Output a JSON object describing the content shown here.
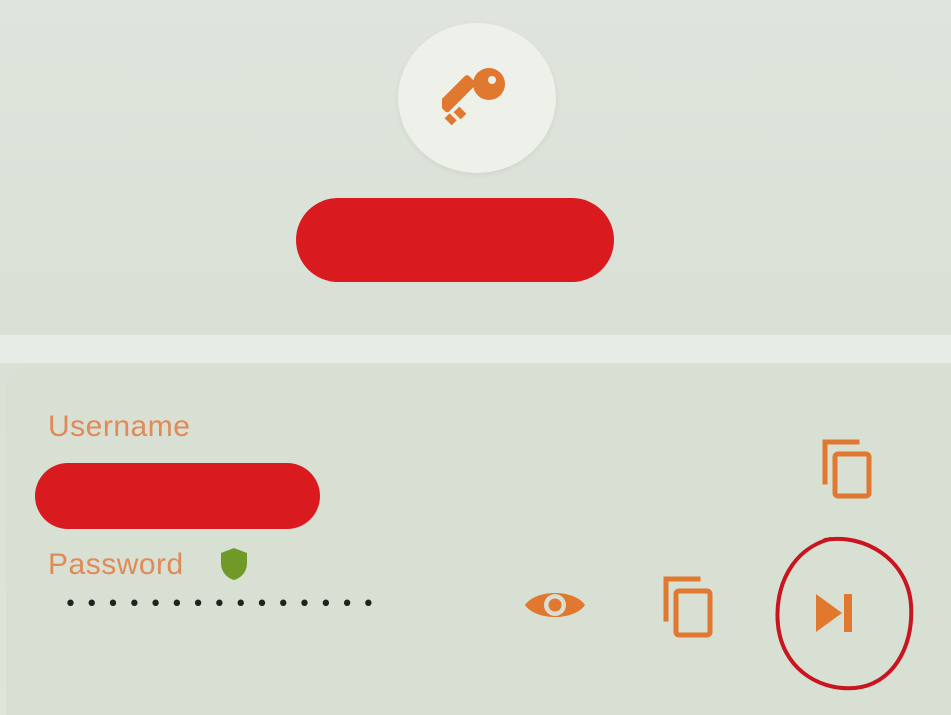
{
  "header": {
    "avatar_icon": "key-icon",
    "title_redacted": true
  },
  "credentials": {
    "username_label": "Username",
    "username_value_redacted": true,
    "username_copy_icon": "copy-icon",
    "password_label": "Password",
    "password_strength_icon": "shield-icon",
    "password_masked": "•••••••••••••••",
    "show_password_icon": "eye-icon",
    "password_copy_icon": "copy-icon",
    "autofill_icon": "skip-next-icon"
  },
  "colors": {
    "accent": "#e0782f",
    "label": "#e08a58",
    "redaction": "#d91a1e",
    "annotation": "#c8151f",
    "shield": "#6f9a28"
  }
}
